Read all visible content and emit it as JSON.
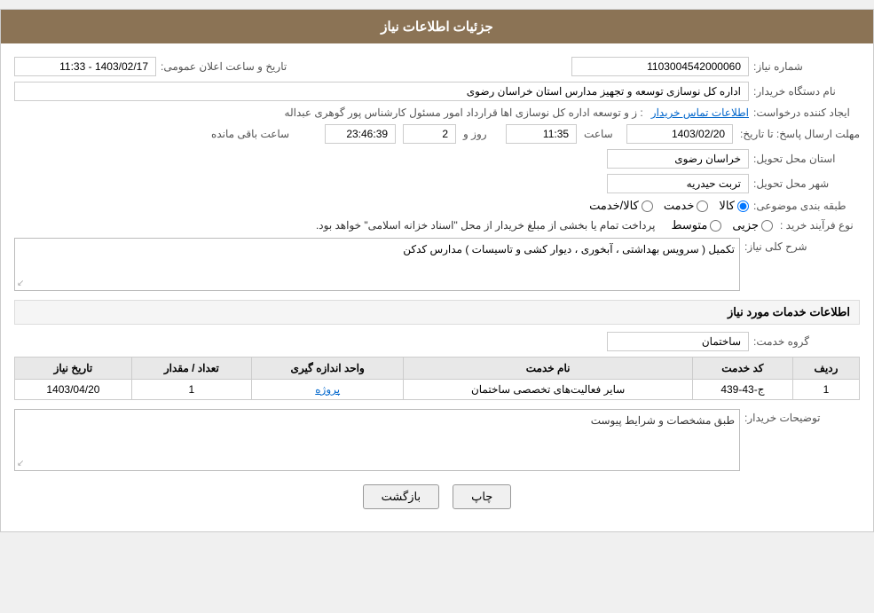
{
  "header": {
    "title": "جزئیات اطلاعات نیاز"
  },
  "fields": {
    "need_number_label": "شماره نیاز:",
    "need_number_value": "1103004542000060",
    "announcement_date_label": "تاریخ و ساعت اعلان عمومی:",
    "announcement_date_value": "1403/02/17 - 11:33",
    "buyer_name_label": "نام دستگاه خریدار:",
    "buyer_name_value": "اداره کل نوسازی  توسعه و تجهیز مدارس استان خراسان رضوی",
    "creator_label": "ایجاد کننده درخواست:",
    "creator_value": "عبداله گوهری پور کارشناس مسئول امور قراردادها  اداره کل نوسازی  توسعه و ز",
    "creator_link": "اطلاعات تماس خریدار",
    "deadline_label": "مهلت ارسال پاسخ: تا تاریخ:",
    "deadline_date": "1403/02/20",
    "deadline_time_label": "ساعت",
    "deadline_time": "11:35",
    "deadline_days_label": "روز و",
    "deadline_days": "2",
    "deadline_remaining_label": "ساعت باقی مانده",
    "deadline_remaining": "23:46:39",
    "province_label": "استان محل تحویل:",
    "province_value": "خراسان رضوی",
    "city_label": "شهر محل تحویل:",
    "city_value": "تربت حیدریه",
    "category_label": "طبقه بندی موضوعی:",
    "category_kala": "کالا",
    "category_khedmat": "خدمت",
    "category_kala_khedmat": "کالا/خدمت",
    "process_label": "نوع فرآیند خرید :",
    "process_jozee": "جزیی",
    "process_motavasset": "متوسط",
    "process_note": "پرداخت تمام یا بخشی از مبلغ خریدار از محل \"اسناد خزانه اسلامی\" خواهد بود.",
    "need_description_label": "شرح کلی نیاز:",
    "need_description_value": "تکمیل ( سرویس بهداشتی ، آبخوری ، دیوار کشی و تاسیسات ) مدارس کدکن",
    "services_title": "اطلاعات خدمات مورد نیاز",
    "service_group_label": "گروه خدمت:",
    "service_group_value": "ساختمان",
    "table": {
      "col_radif": "ردیف",
      "col_code": "کد خدمت",
      "col_name": "نام خدمت",
      "col_unit": "واحد اندازه گیری",
      "col_count": "تعداد / مقدار",
      "col_date": "تاریخ نیاز",
      "rows": [
        {
          "radif": "1",
          "code": "ج-43-439",
          "name": "سایر فعالیت‌های تخصصی ساختمان",
          "unit": "پروژه",
          "count": "1",
          "date": "1403/04/20"
        }
      ]
    },
    "buyer_notes_label": "توضیحات خریدار:",
    "buyer_notes_value": "طبق مشخصات و شرایط پیوست"
  },
  "buttons": {
    "print": "چاپ",
    "back": "بازگشت"
  },
  "colors": {
    "header_bg": "#8B7355",
    "link": "#0066cc",
    "table_header_bg": "#e8e8e8"
  }
}
